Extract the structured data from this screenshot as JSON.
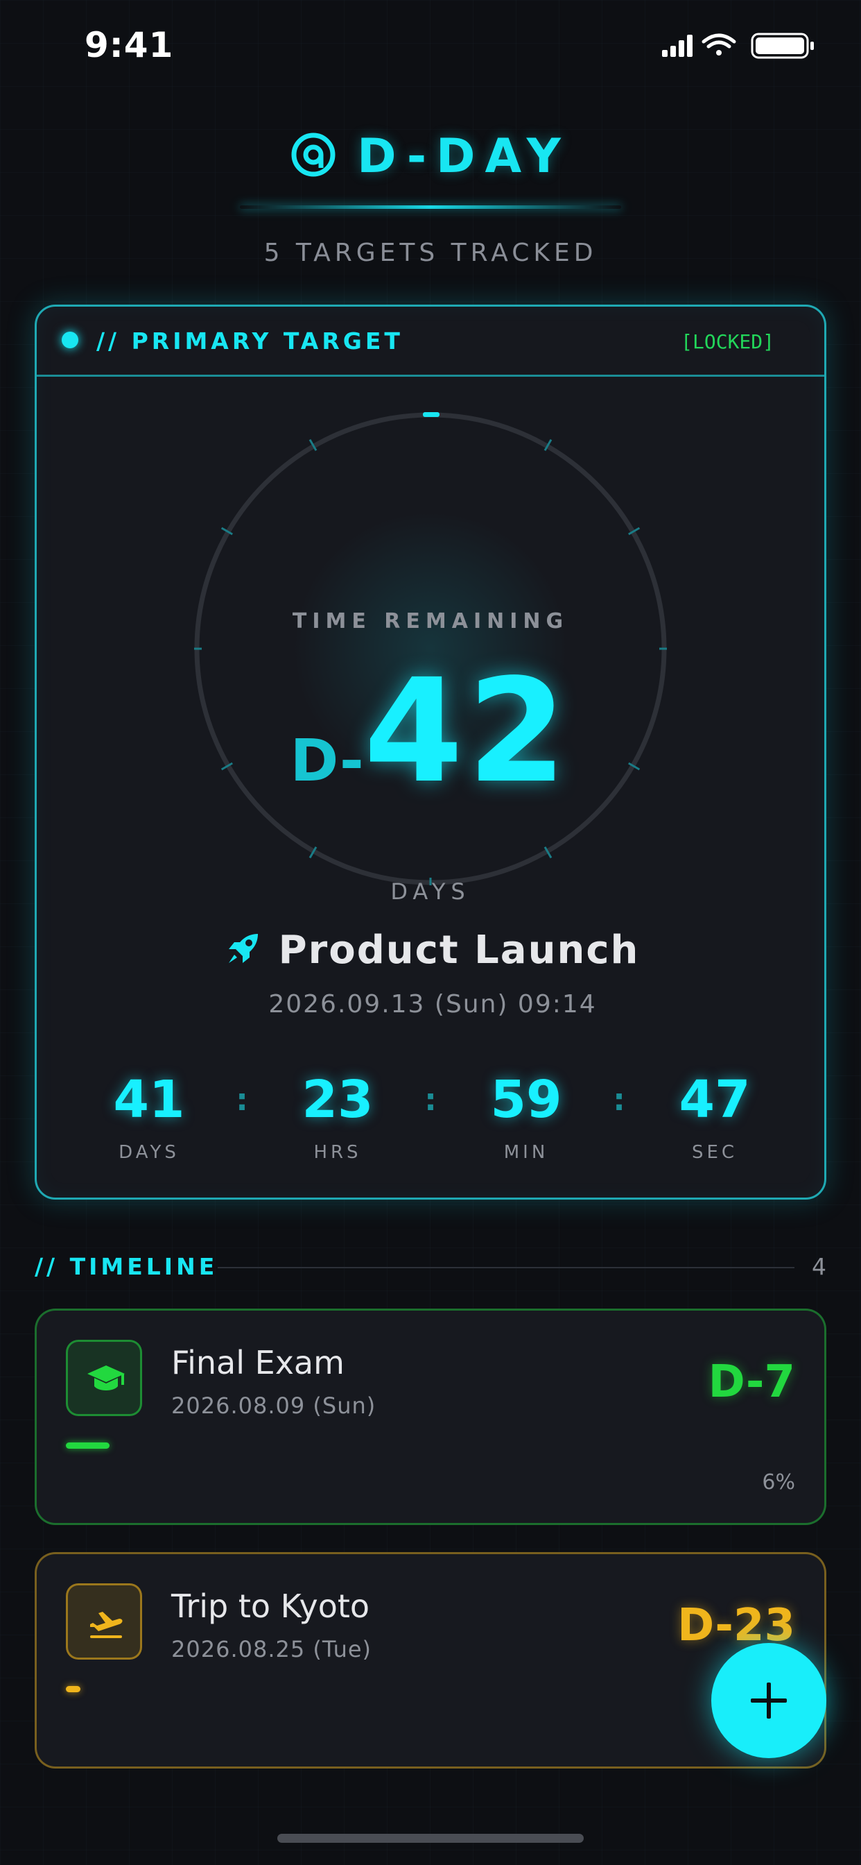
{
  "status_bar": {
    "time": "9:41"
  },
  "header": {
    "title": "D-DAY",
    "subtitle": "5 TARGETS TRACKED"
  },
  "primary": {
    "section_label": "// PRIMARY TARGET",
    "tag": "[LOCKED]",
    "time_remaining_label": "TIME REMAINING",
    "dday_prefix": "D-",
    "dday_value": "42",
    "unit_label": "DAYS",
    "event_title": "Product Launch",
    "event_icon": "rocket-icon",
    "event_datetime": "2026.09.13 (Sun) 09:14",
    "countdown": [
      {
        "value": "41",
        "label": "DAYS"
      },
      {
        "value": "23",
        "label": "HRS"
      },
      {
        "value": "59",
        "label": "MIN"
      },
      {
        "value": "47",
        "label": "SEC"
      }
    ],
    "separator": ":"
  },
  "timeline": {
    "label": "// TIMELINE",
    "count": "4",
    "items": [
      {
        "title": "Final Exam",
        "date": "2026.08.09 (Sun)",
        "dday": "D-7",
        "percent": "6%",
        "progress": 0.06,
        "color": "#22d83f",
        "icon": "graduation-cap-icon"
      },
      {
        "title": "Trip to Kyoto",
        "date": "2026.08.25 (Tue)",
        "dday": "D-23",
        "progress": 0.02,
        "color": "#f0b51c",
        "icon": "plane-departure-icon"
      }
    ]
  },
  "colors": {
    "accent": "#18e6f2",
    "background": "#0d0f13",
    "card": "#16181e",
    "locked": "#22d65a"
  },
  "fab": {
    "icon": "plus-icon"
  }
}
